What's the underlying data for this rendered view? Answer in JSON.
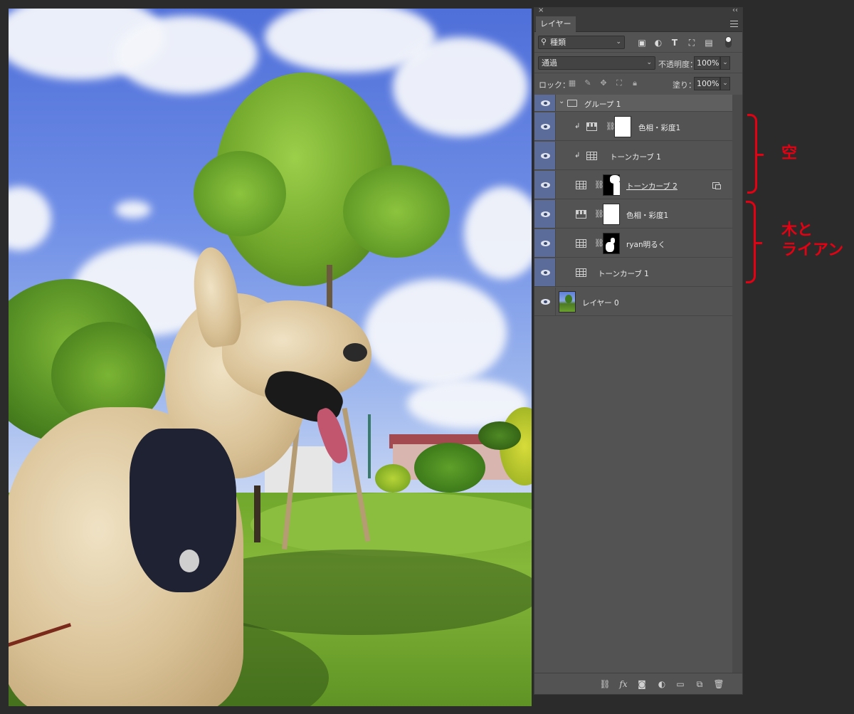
{
  "panel": {
    "tab": "レイヤー",
    "collapse_glyph": "‹‹",
    "close_glyph": "×",
    "filter": {
      "label": "種類",
      "icons": [
        "image-filter-icon",
        "adjustment-filter-icon",
        "type-filter-icon",
        "shape-filter-icon",
        "smart-object-filter-icon",
        "filter-toggle-icon"
      ]
    },
    "blend_mode": "通過",
    "opacity_label": "不透明度：",
    "opacity_value": "100%",
    "lock_label": "ロック：",
    "fill_label": "塗り：",
    "fill_value": "100%"
  },
  "layers": [
    {
      "name": "グループ 1",
      "kind": "group",
      "visible": true
    },
    {
      "name": "色相・彩度1",
      "kind": "hue-saturation",
      "clipped": true,
      "mask": "white",
      "visible": true
    },
    {
      "name": "トーンカーブ 1",
      "kind": "curves",
      "clipped": true,
      "visible": true
    },
    {
      "name": "トーンカーブ 2",
      "kind": "curves",
      "mask": "sky",
      "smart": true,
      "visible": true
    },
    {
      "name": "色相・彩度1",
      "kind": "hue-saturation",
      "mask": "white",
      "visible": true
    },
    {
      "name": "ryan明るく",
      "kind": "curves",
      "mask": "dog",
      "visible": true
    },
    {
      "name": "トーンカーブ 1",
      "kind": "curves",
      "visible": true
    },
    {
      "name": "レイヤー 0",
      "kind": "pixel",
      "visible": true
    }
  ],
  "bottom_icons": [
    "link-layers-icon",
    "fx-icon",
    "add-mask-icon",
    "new-adjustment-icon",
    "new-group-icon",
    "new-layer-icon",
    "trash-icon"
  ],
  "bottom_glyphs": {
    "fx": "fx"
  },
  "annotations": {
    "sky": "空",
    "tree_dog_line1": "木と",
    "tree_dog_line2": "ライアン"
  },
  "colors": {
    "annotation": "#e60012",
    "eye_column": "#5c6c9a",
    "panel_bg": "#535353"
  }
}
